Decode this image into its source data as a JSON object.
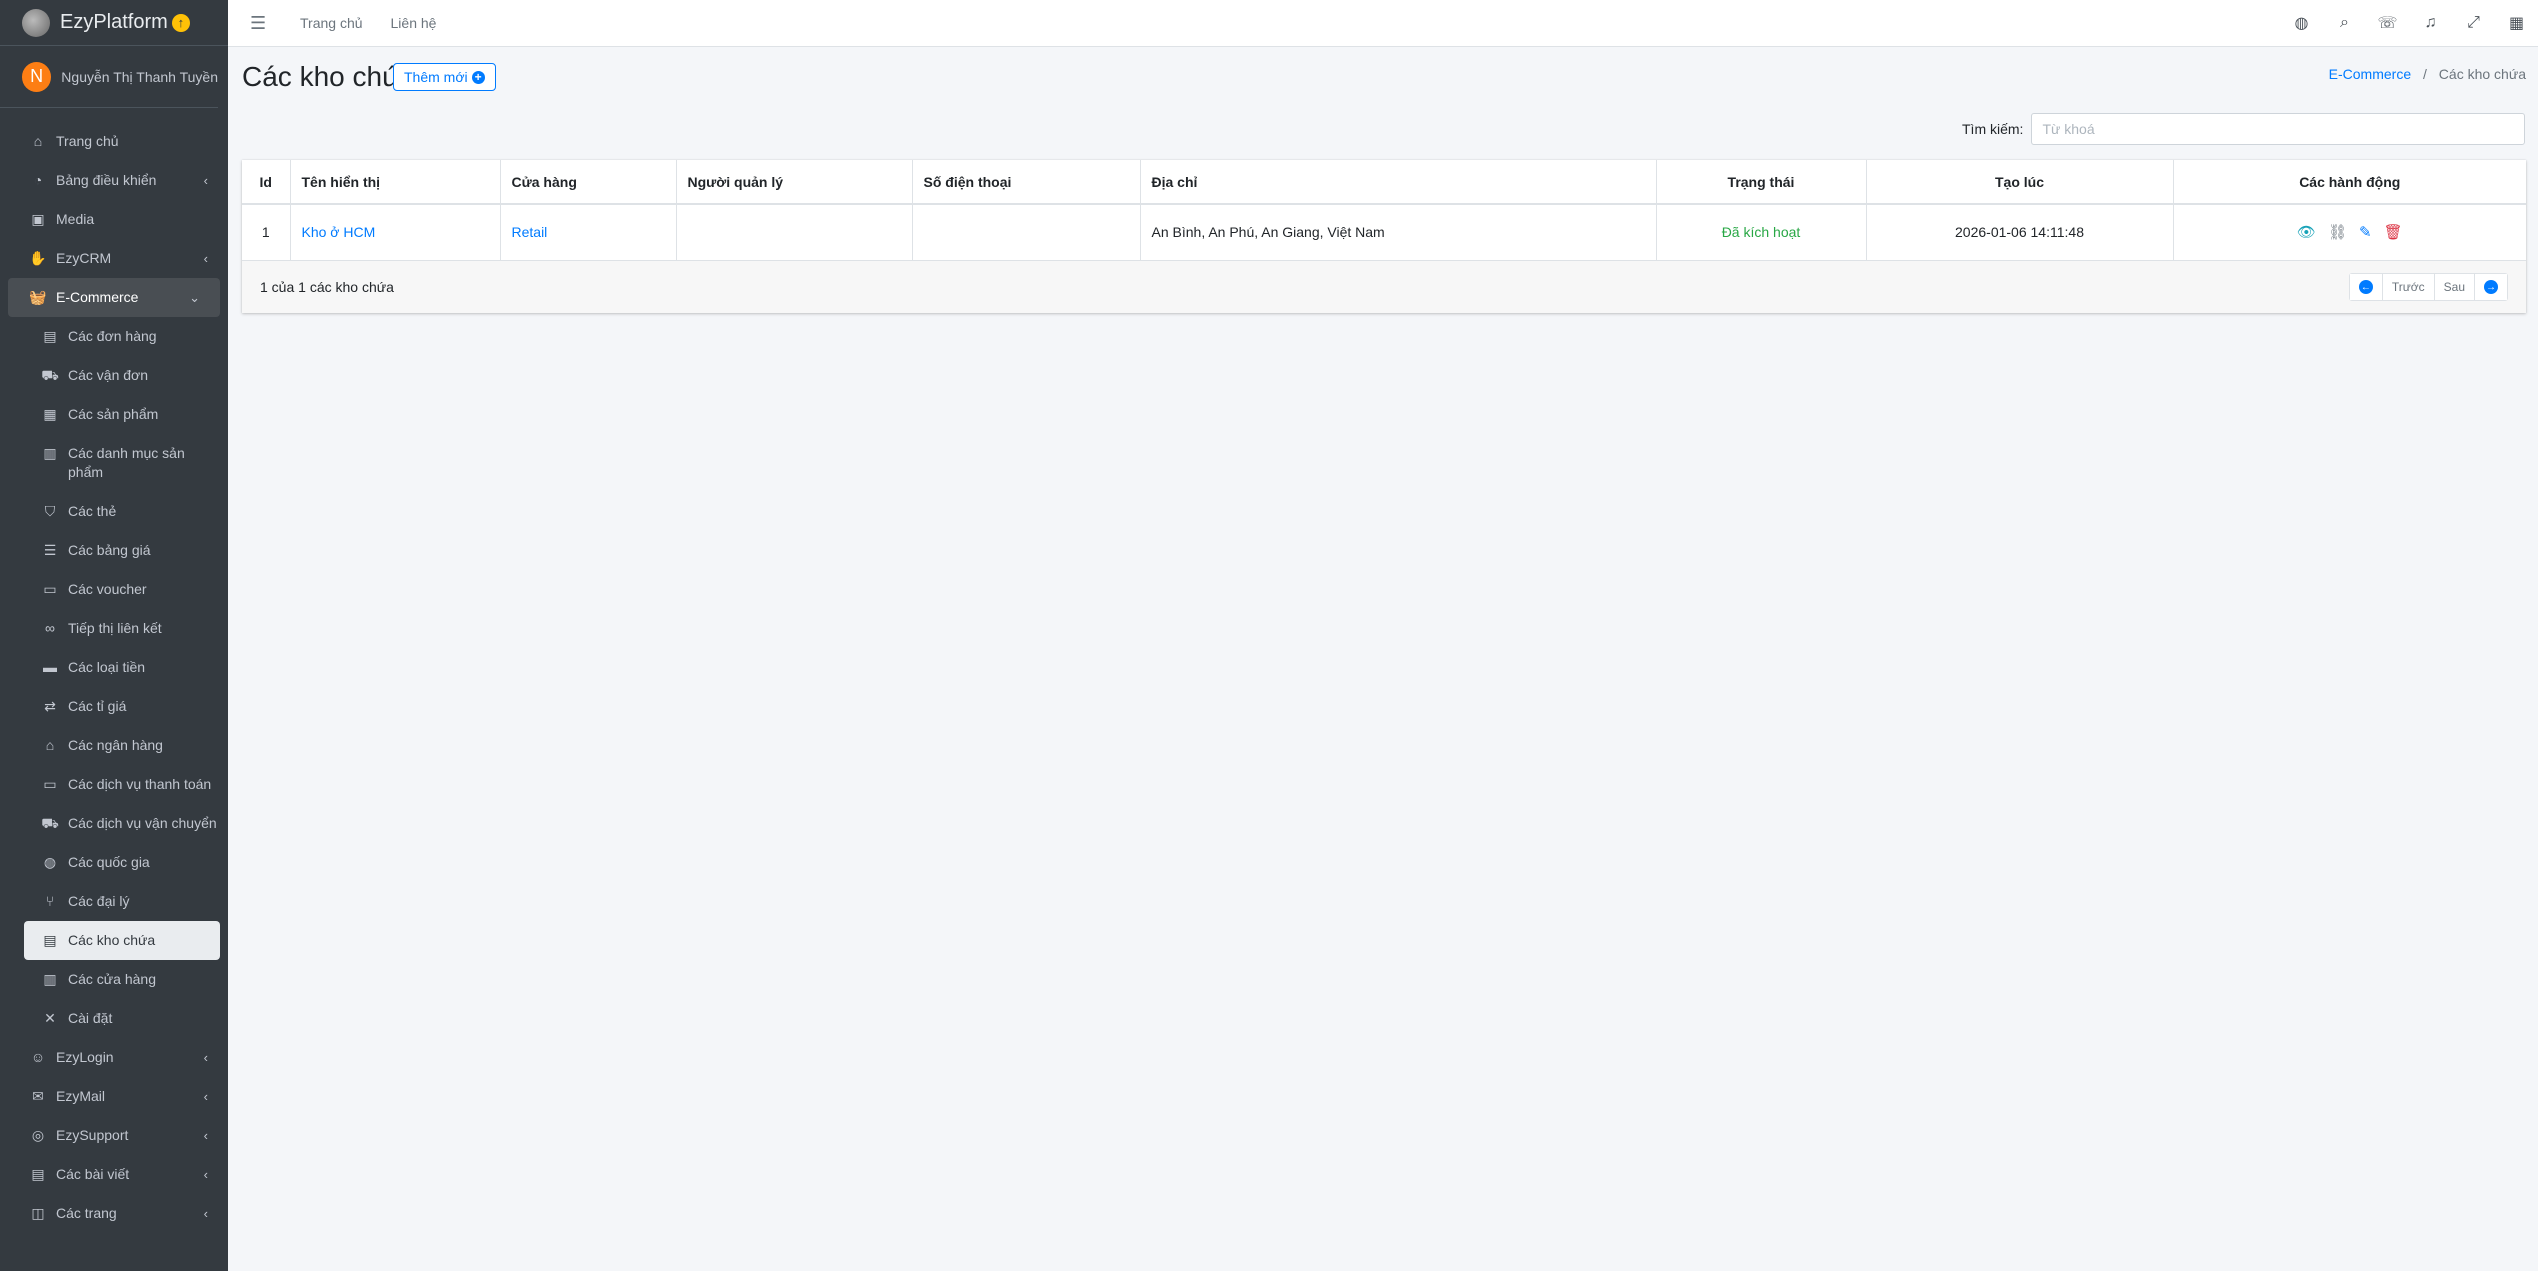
{
  "brand": {
    "name": "EzyPlatform",
    "badge": "↑"
  },
  "user": {
    "initial": "N",
    "name": "Nguyễn Thị Thanh Tuyền"
  },
  "sidebar": {
    "items": [
      {
        "label": "Trang chủ",
        "icon": "home-icon"
      },
      {
        "label": "Bảng điều khiển",
        "icon": "dashboard-icon"
      },
      {
        "label": "Media",
        "icon": "image-icon"
      },
      {
        "label": "EzyCRM",
        "icon": "handshake-icon"
      },
      {
        "label": "E-Commerce",
        "icon": "basket-icon"
      }
    ],
    "ecommerce_sub": [
      {
        "label": "Các đơn hàng"
      },
      {
        "label": "Các vận đơn"
      },
      {
        "label": "Các sản phẩm"
      },
      {
        "label": "Các danh mục sản phẩm"
      },
      {
        "label": "Các thẻ"
      },
      {
        "label": "Các bảng giá"
      },
      {
        "label": "Các voucher"
      },
      {
        "label": "Tiếp thị liên kết"
      },
      {
        "label": "Các loại tiền"
      },
      {
        "label": "Các tỉ giá"
      },
      {
        "label": "Các ngân hàng"
      },
      {
        "label": "Các dịch vụ thanh toán"
      },
      {
        "label": "Các dịch vụ vận chuyển"
      },
      {
        "label": "Các quốc gia"
      },
      {
        "label": "Các đại lý"
      },
      {
        "label": "Các kho chứa"
      },
      {
        "label": "Các cửa hàng"
      },
      {
        "label": "Cài đặt"
      }
    ],
    "bottom": [
      {
        "label": "EzyLogin"
      },
      {
        "label": "EzyMail"
      },
      {
        "label": "EzySupport"
      },
      {
        "label": "Các bài viết"
      },
      {
        "label": "Các trang"
      }
    ]
  },
  "topbar": {
    "links": [
      "Trang chủ",
      "Liên hệ"
    ]
  },
  "page": {
    "title": "Các kho chứa",
    "add_label": "Thêm mới",
    "breadcrumb": {
      "parent": "E-Commerce",
      "current": "Các kho chứa"
    }
  },
  "search": {
    "label": "Tìm kiếm:",
    "placeholder": "Từ khoá"
  },
  "table": {
    "headers": [
      "Id",
      "Tên hiển thị",
      "Cửa hàng",
      "Người quản lý",
      "Số điện thoại",
      "Địa chỉ",
      "Trạng thái",
      "Tạo lúc",
      "Các hành động"
    ],
    "rows": [
      {
        "id": "1",
        "name": "Kho ở HCM",
        "store": "Retail",
        "manager": "",
        "phone": "",
        "address": "An Bình, An Phú, An Giang, Việt Nam",
        "status": "Đã kích hoạt",
        "created": "2026-01-06 14:11:48"
      }
    ]
  },
  "footer": {
    "summary": "1 của 1 các kho chứa",
    "prev": "Trước",
    "next": "Sau"
  },
  "colors": {
    "sidebar": "#343a40",
    "accent": "#007bff",
    "success": "#28a745",
    "danger": "#dc3545"
  }
}
